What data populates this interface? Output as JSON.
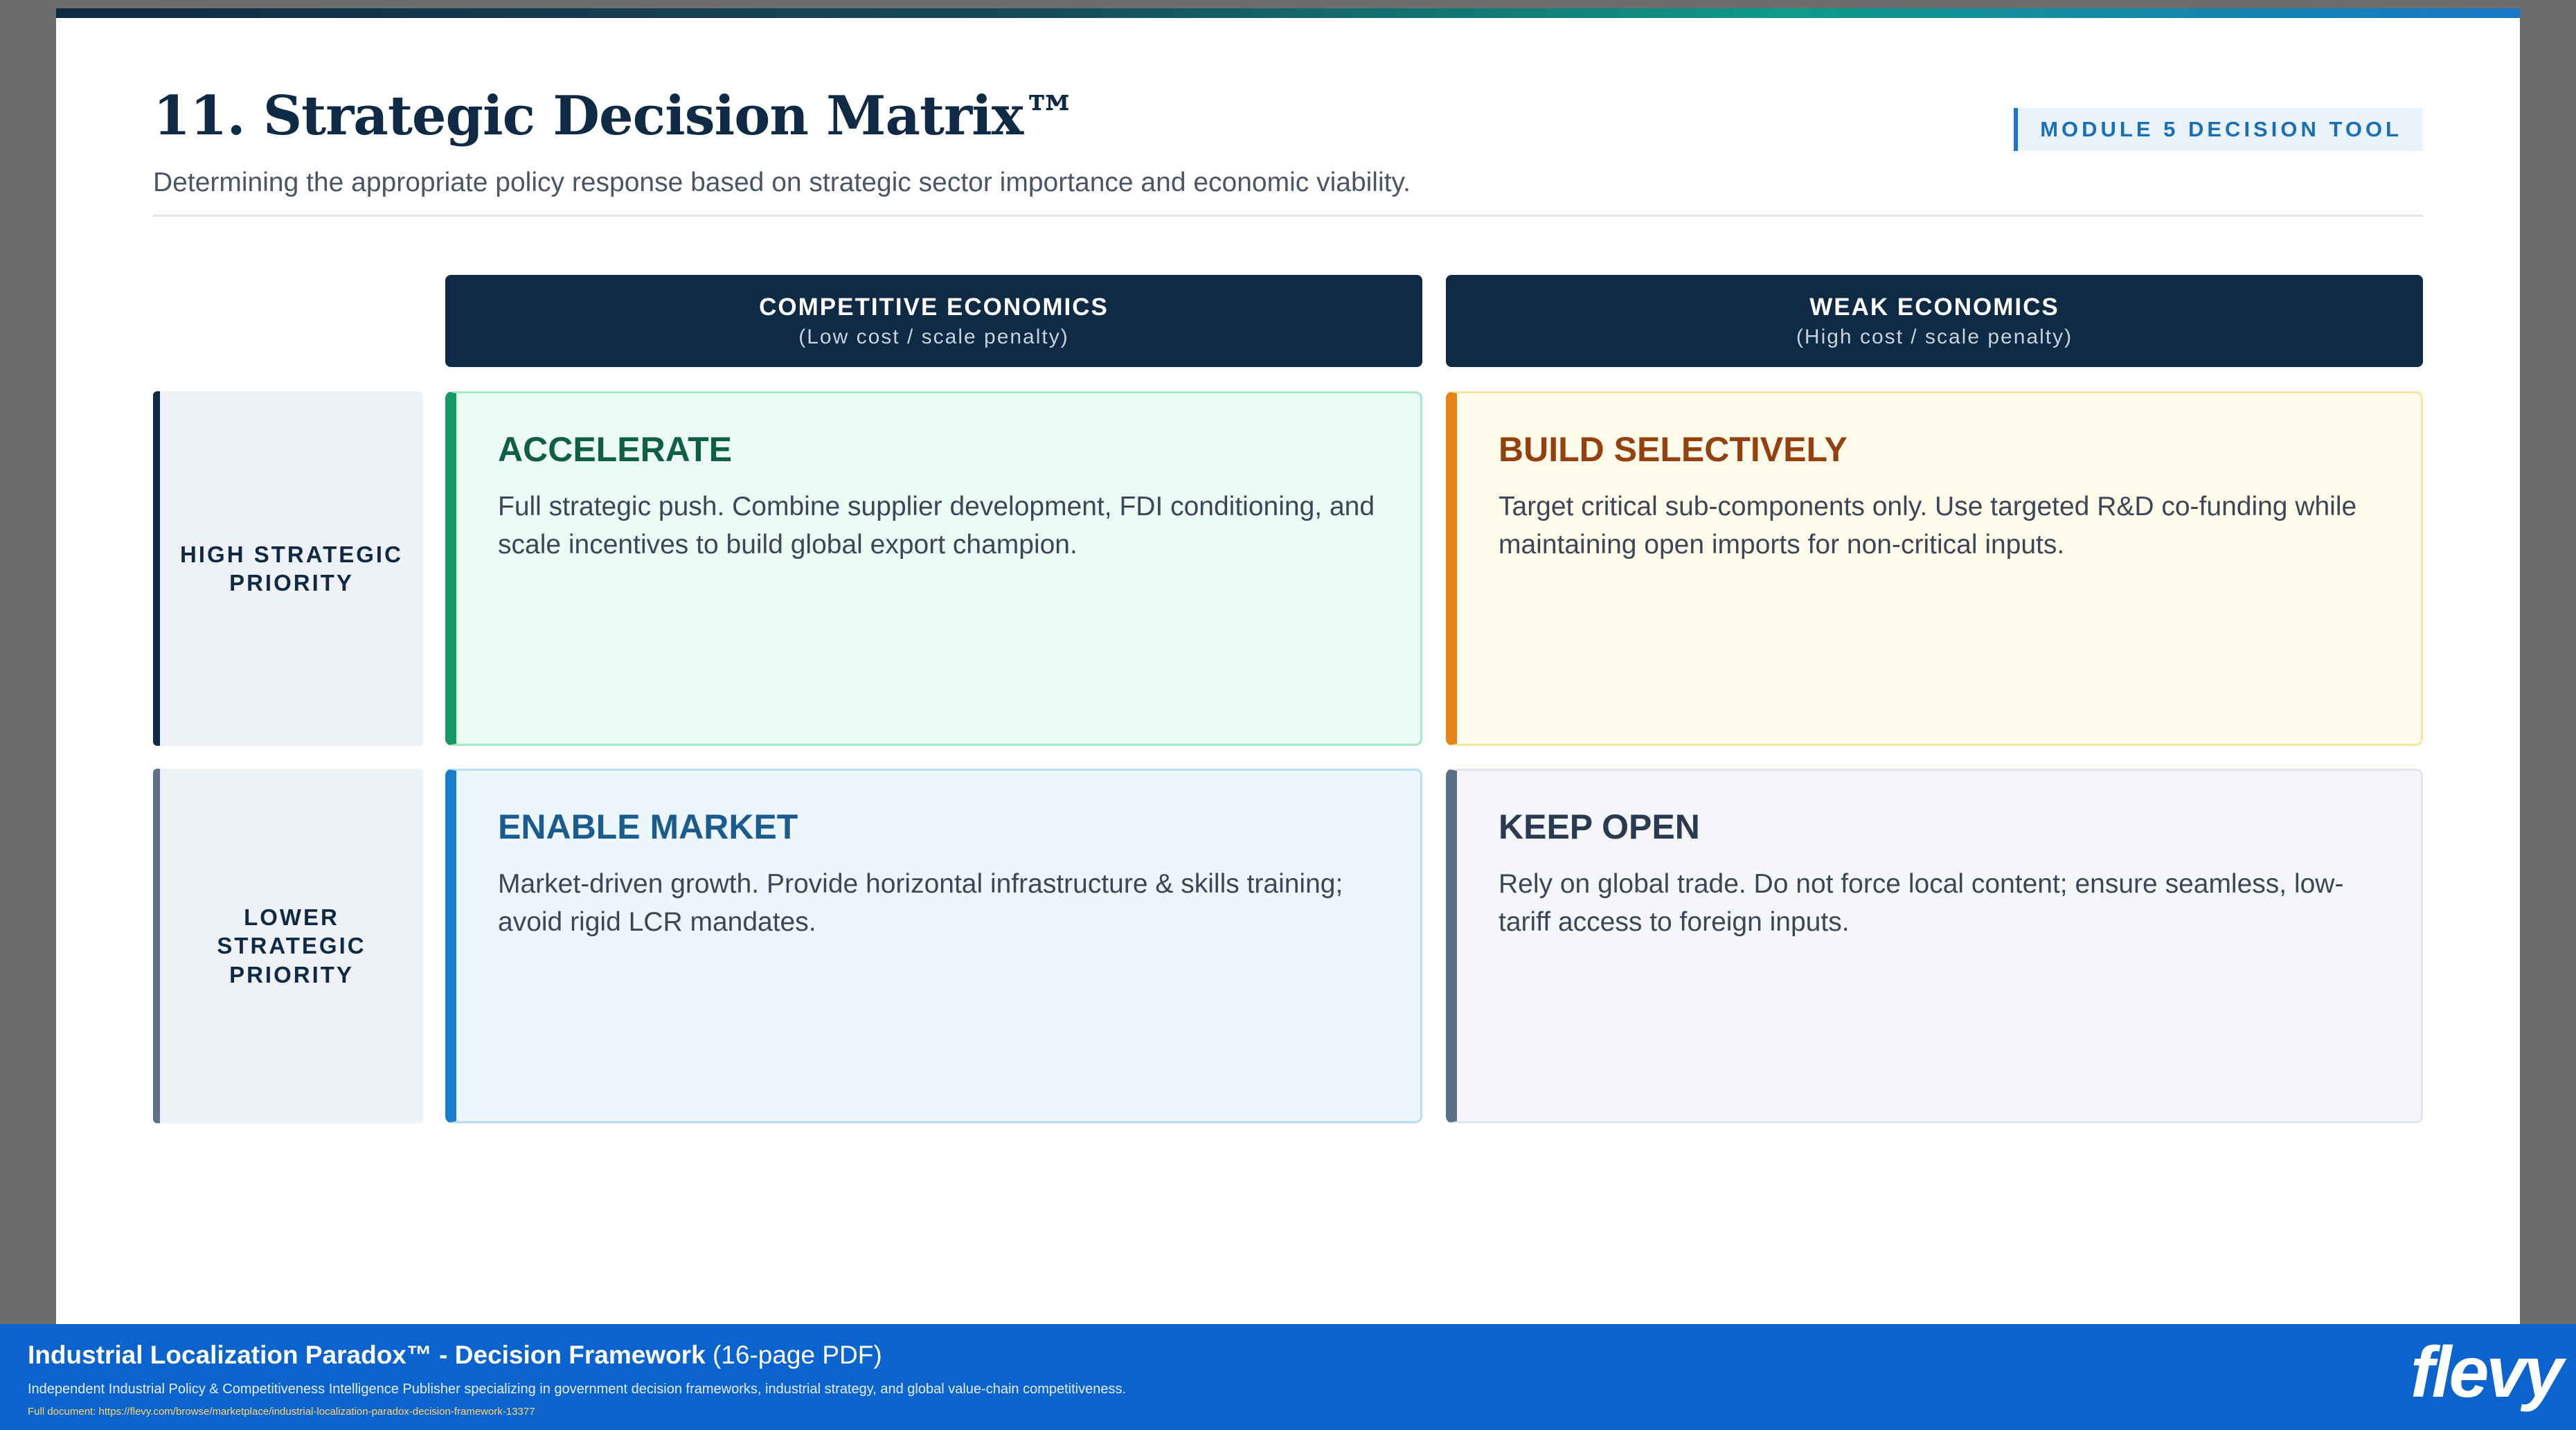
{
  "slide": {
    "title": "11. Strategic Decision Matrix™",
    "subtitle": "Determining the appropriate policy response based on strategic sector importance and economic viability.",
    "module_tag": "MODULE 5 DECISION TOOL"
  },
  "columns": [
    {
      "heading": "COMPETITIVE ECONOMICS",
      "sub": "(Low cost / scale penalty)"
    },
    {
      "heading": "WEAK ECONOMICS",
      "sub": "(High cost / scale penalty)"
    }
  ],
  "rows": [
    {
      "label": "HIGH STRATEGIC PRIORITY"
    },
    {
      "label": "LOWER STRATEGIC PRIORITY"
    }
  ],
  "cells": {
    "accelerate": {
      "title": "ACCELERATE",
      "body": "Full strategic push. Combine supplier development, FDI conditioning, and scale incentives to build global export champion."
    },
    "build_selectively": {
      "title": "BUILD SELECTIVELY",
      "body": "Target critical sub-components only. Use targeted R&D co-funding while maintaining open imports for non-critical inputs."
    },
    "enable_market": {
      "title": "ENABLE MARKET",
      "body": "Market-driven growth. Provide horizontal infrastructure & skills training; avoid rigid LCR mandates."
    },
    "keep_open": {
      "title": "KEEP OPEN",
      "body": "Rely on global trade. Do not force local content; ensure seamless, low-tariff access to foreign inputs."
    }
  },
  "colors": {
    "navy": "#0f2a44",
    "accelerate_accent": "#139a62",
    "build_accent": "#e58416",
    "enable_accent": "#1a7fcb",
    "keep_accent": "#5e7088",
    "footer_blue": "#0b63ce"
  },
  "footer": {
    "title": "Industrial Localization Paradox™ - Decision Framework",
    "title_suffix": "(16-page PDF)",
    "description": "Independent Industrial Policy & Competitiveness Intelligence Publisher specializing in government decision frameworks, industrial strategy, and global value-chain competitiveness.",
    "url": "Full document: https://flevy.com/browse/marketplace/industrial-localization-paradox-decision-framework-13377",
    "logo": "flevy"
  }
}
